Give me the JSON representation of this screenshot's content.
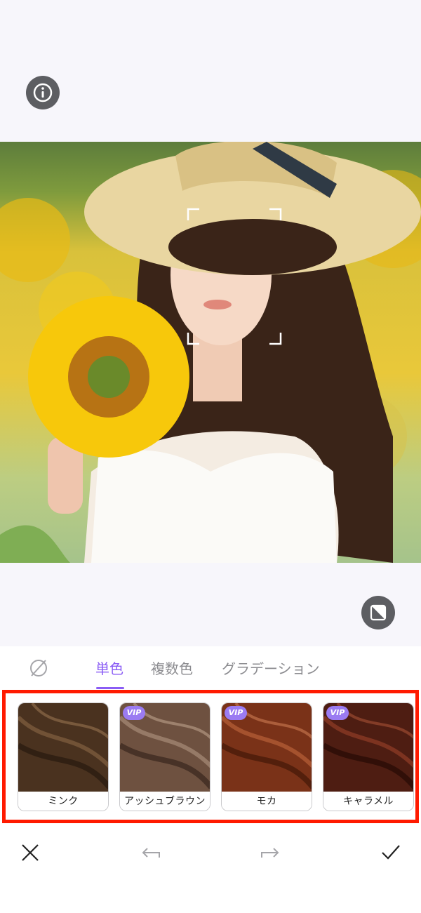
{
  "toolbar": {
    "info_icon": "info-icon",
    "compare_icon": "compare-icon"
  },
  "tabs": {
    "none_icon": "no-color-icon",
    "items": [
      {
        "label": "単色",
        "active": true
      },
      {
        "label": "複数色",
        "active": false
      },
      {
        "label": "グラデーション",
        "active": false
      }
    ]
  },
  "swatches": [
    {
      "label": "ミンク",
      "vip": false,
      "color": "#4a321f"
    },
    {
      "label": "アッシュブラウン",
      "vip": true,
      "vip_label": "VIP",
      "color": "#6e5140"
    },
    {
      "label": "モカ",
      "vip": true,
      "vip_label": "VIP",
      "color": "#7a3218"
    },
    {
      "label": "キャラメル",
      "vip": true,
      "vip_label": "VIP",
      "color": "#4e1d12"
    }
  ],
  "bottom": {
    "close_icon": "close-icon",
    "undo_icon": "undo-icon",
    "redo_icon": "redo-icon",
    "confirm_icon": "check-icon"
  },
  "colors": {
    "accent": "#8a5cf5",
    "highlight_border": "#ff1a00",
    "vip_badge": "#9b7bf2"
  }
}
